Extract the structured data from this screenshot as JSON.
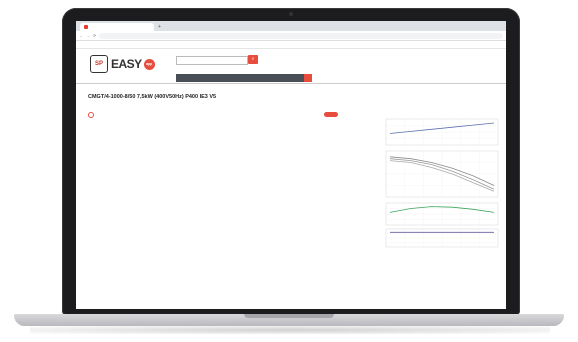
{
  "browser": {
    "tab_title": "",
    "new_tab": "+",
    "url": "",
    "nav_back": "←",
    "nav_forward": "→",
    "nav_reload": "⟳",
    "bookmarks": []
  },
  "app": {
    "logo_text": "EASY",
    "logo_badge": "SP",
    "logo_circle": "app",
    "search_placeholder": "",
    "search_icon": "search-icon",
    "user_links": "",
    "menu": [],
    "colors": {
      "accent": "#e74c3c",
      "menubar": "#4a4f57"
    }
  },
  "breadcrumbs": [],
  "page": {
    "title": "CMGT/4-1000-8/50 7,5kW (400V50Hz) P400 IE3 V5",
    "subtabs": [],
    "active_subtab": 1,
    "action_buttons": [],
    "section_header": ""
  },
  "properties": [],
  "chart_data": {
    "type": "line",
    "title": "",
    "panels": [
      {
        "name": "",
        "series": [
          {
            "name": "",
            "values": [
              0.9,
              1.1,
              1.3,
              1.5,
              1.7,
              1.9
            ]
          }
        ]
      },
      {
        "name": "",
        "series": [
          {
            "name": "",
            "values": [
              1.0,
              0.95,
              0.85,
              0.7,
              0.5,
              0.25
            ]
          },
          {
            "name": "",
            "values": [
              0.95,
              0.9,
              0.8,
              0.62,
              0.4,
              0.15
            ]
          },
          {
            "name": "",
            "values": [
              0.9,
              0.85,
              0.72,
              0.55,
              0.32,
              0.1
            ]
          }
        ]
      },
      {
        "name": "",
        "series": [
          {
            "name": "",
            "values": [
              0.4,
              0.55,
              0.62,
              0.6,
              0.52,
              0.4
            ]
          }
        ]
      },
      {
        "name": "",
        "series": [
          {
            "name": "",
            "values": [
              0.5,
              0.5,
              0.5,
              0.5,
              0.5,
              0.5
            ]
          }
        ]
      }
    ],
    "xlabel": "",
    "ylabel": "",
    "grid": true,
    "legend": "none"
  },
  "form": {
    "rows": []
  }
}
